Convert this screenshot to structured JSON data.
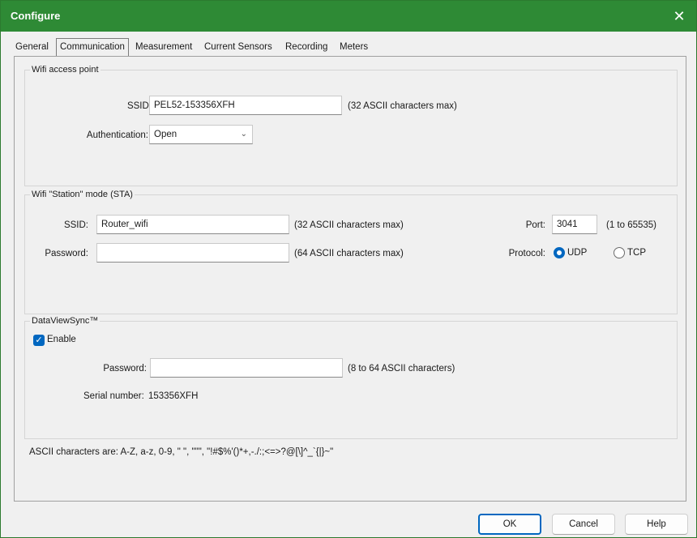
{
  "window": {
    "title": "Configure",
    "close_glyph": "✕"
  },
  "tabs": [
    {
      "label": "General"
    },
    {
      "label": "Communication",
      "active": true
    },
    {
      "label": "Measurement"
    },
    {
      "label": "Current Sensors"
    },
    {
      "label": "Recording"
    },
    {
      "label": "Meters"
    }
  ],
  "wifi_ap": {
    "legend": "Wifi access point",
    "ssid_label": "SSID:",
    "ssid_value": "PEL52-153356XFH",
    "ssid_hint": "(32 ASCII characters max)",
    "auth_label": "Authentication:",
    "auth_value": "Open",
    "auth_icon": "chevron-down-icon"
  },
  "wifi_sta": {
    "legend": "Wifi \"Station\" mode (STA)",
    "ssid_label": "SSID:",
    "ssid_value": "Router_wifi",
    "ssid_hint": "(32 ASCII characters max)",
    "password_label": "Password:",
    "password_value": "",
    "password_hint": "(64 ASCII characters max)",
    "port_label": "Port:",
    "port_value": "3041",
    "port_hint": "(1 to 65535)",
    "protocol_label": "Protocol:",
    "protocol_options": [
      {
        "label": "UDP",
        "selected": true
      },
      {
        "label": "TCP",
        "selected": false
      }
    ]
  },
  "dataviewsync": {
    "legend": "DataViewSync™",
    "enable_label": "Enable",
    "enable_checked": true,
    "password_label": "Password:",
    "password_value": "",
    "password_hint": "(8 to 64 ASCII characters)",
    "serial_label": "Serial number:",
    "serial_value": "153356XFH"
  },
  "ascii_note": "ASCII characters are: A-Z, a-z, 0-9, \" \", \"\"\", \"!#$%'()*+,-./:;<=>?@[\\]^_`{|}~\"",
  "buttons": {
    "ok": "OK",
    "cancel": "Cancel",
    "help": "Help"
  },
  "colors": {
    "titlebar": "#2e8a35",
    "accent": "#0067c0"
  }
}
